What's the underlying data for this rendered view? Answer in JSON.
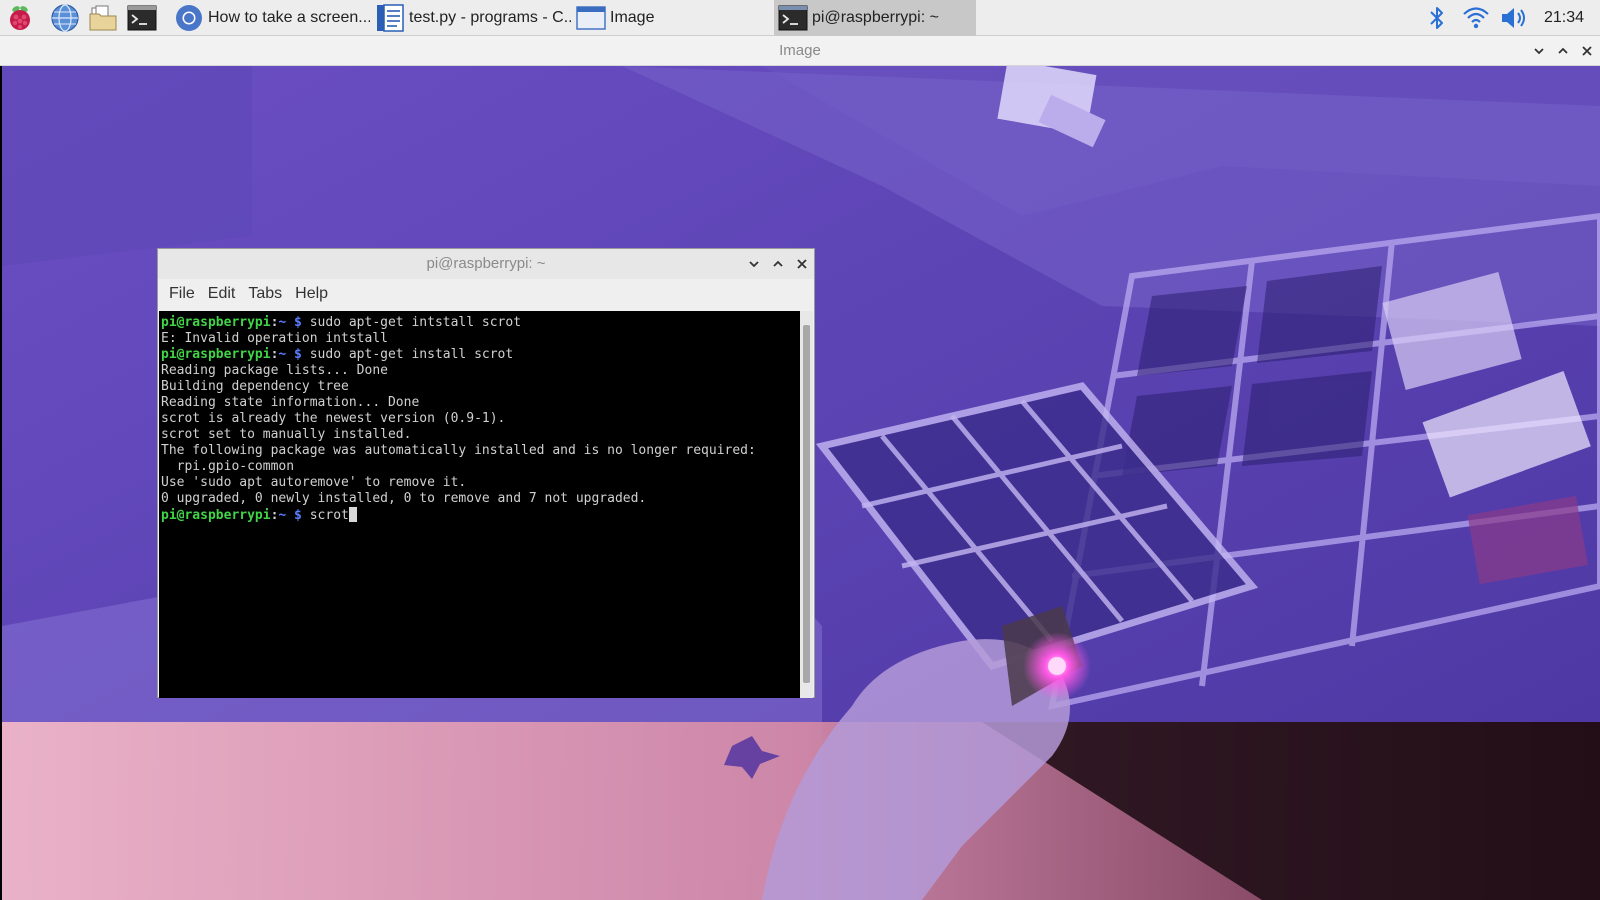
{
  "taskbar": {
    "launchers": [
      {
        "name": "raspberry-menu-icon"
      },
      {
        "name": "web-browser-icon"
      },
      {
        "name": "file-manager-icon"
      },
      {
        "name": "terminal-icon"
      }
    ],
    "tasks": [
      {
        "label": "How to take a screen...",
        "icon": "chromium-icon",
        "active": false
      },
      {
        "label": "test.py - programs - C...",
        "icon": "text-editor-icon",
        "active": false
      },
      {
        "label": "Image",
        "icon": "window-icon",
        "active": false
      },
      {
        "label": "pi@raspberrypi: ~",
        "icon": "terminal-icon",
        "active": true
      }
    ],
    "tray": [
      "bluetooth-icon",
      "wifi-icon",
      "volume-icon"
    ],
    "clock": "21:34"
  },
  "viewer": {
    "title": "Image"
  },
  "terminal": {
    "title": "pi@raspberrypi: ~",
    "menu": [
      "File",
      "Edit",
      "Tabs",
      "Help"
    ],
    "prompt": {
      "user": "pi@raspberrypi",
      "sep": ":",
      "path": "~",
      "symbol": " $ "
    },
    "lines": [
      {
        "type": "cmd",
        "text": "sudo apt-get intstall scrot"
      },
      {
        "type": "out",
        "text": "E: Invalid operation intstall"
      },
      {
        "type": "cmd",
        "text": "sudo apt-get install scrot"
      },
      {
        "type": "out",
        "text": "Reading package lists... Done"
      },
      {
        "type": "out",
        "text": "Building dependency tree"
      },
      {
        "type": "out",
        "text": "Reading state information... Done"
      },
      {
        "type": "out",
        "text": "scrot is already the newest version (0.9-1)."
      },
      {
        "type": "out",
        "text": "scrot set to manually installed."
      },
      {
        "type": "out",
        "text": "The following package was automatically installed and is no longer required:"
      },
      {
        "type": "out",
        "text": "  rpi.gpio-common"
      },
      {
        "type": "out",
        "text": "Use 'sudo apt autoremove' to remove it."
      },
      {
        "type": "out",
        "text": "0 upgraded, 0 newly installed, 0 to remove and 7 not upgraded."
      },
      {
        "type": "cmd",
        "text": "scrot",
        "cursor": true
      }
    ]
  }
}
